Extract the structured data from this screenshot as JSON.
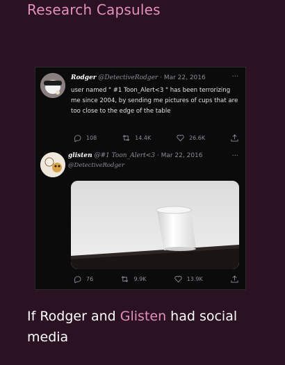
{
  "heading": "Research Capsules",
  "tweet1": {
    "name": "Rodger",
    "handle": "@DetectiveRodger",
    "date": "Mar 22, 2016",
    "more": "···",
    "text": "user named \" #1 Toon_Alert<3 \" has been terrorizing me since 2004, by sending me pictures of cups that are too close to the edge of the table",
    "stats": {
      "replies": "108",
      "retweets": "14.4K",
      "likes": "26.6K"
    }
  },
  "tweet2": {
    "name": "glisten",
    "handle": "@#1 Toon_Alert<3",
    "date": "Mar 22, 2016",
    "more": "···",
    "reply_to": "@DetectiveRodger",
    "stats": {
      "replies": "76",
      "retweets": "9.9K",
      "likes": "13.9K"
    }
  },
  "caption": {
    "before": "If Rodger and ",
    "highlight": "Glisten",
    "after": " had social media"
  },
  "colors": {
    "background": "#2b1222",
    "accent": "#e58fbf"
  }
}
